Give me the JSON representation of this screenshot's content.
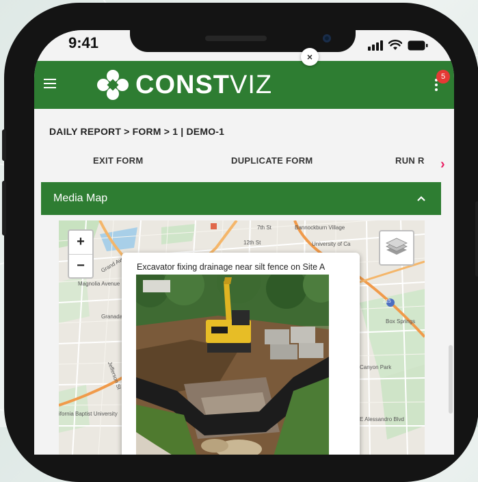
{
  "status_bar": {
    "time": "9:41"
  },
  "app": {
    "logo_bold": "CONST",
    "logo_light": "VIZ",
    "notification_count": "5"
  },
  "breadcrumb": "DAILY REPORT > FORM > 1 | DEMO-1",
  "actions": {
    "exit": "EXIT FORM",
    "duplicate": "DUPLICATE FORM",
    "run": "RUN R"
  },
  "panel": {
    "title": "Media Map"
  },
  "map": {
    "zoom_in": "+",
    "zoom_out": "−",
    "close": "×",
    "popup_caption": "Excavator fixing drainage near silt fence on Site A",
    "labels": {
      "magnolia": "Magnolia Avenue",
      "grand_ave": "Grand Ave",
      "university": "University of Ca",
      "bannockburn": "Bannockburn Village",
      "box_springs": "Box Springs",
      "canyon_park": "Canyon Park",
      "alessandro": "E Alessandro Blvd",
      "baptist": "ifornia Baptist University",
      "granada": "Granada",
      "jefferson": "Jefferson St",
      "seventh": "7th St",
      "twelfth": "12th St",
      "route": "215"
    }
  },
  "colors": {
    "brand_green": "#2e7d32",
    "badge_red": "#e53935",
    "scroll_arrow": "#e91e63"
  }
}
